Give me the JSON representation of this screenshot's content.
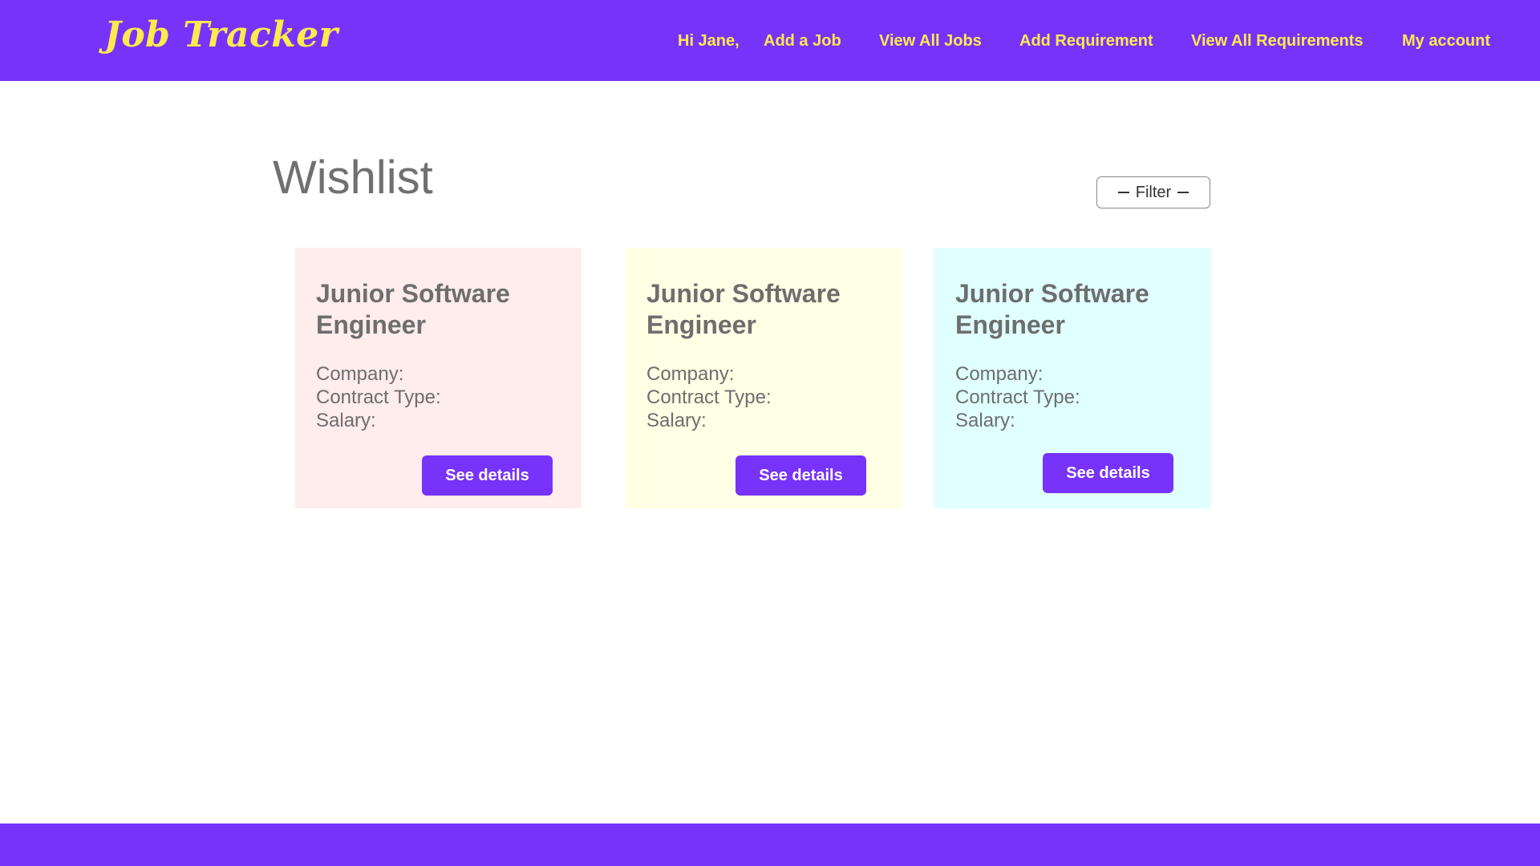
{
  "header": {
    "logo": "Job Tracker",
    "greeting": "Hi Jane,",
    "nav": {
      "add_job": "Add a Job",
      "view_jobs": "View All Jobs",
      "add_requirement": "Add Requirement",
      "view_requirements": "View All Requirements",
      "my_account": "My account"
    }
  },
  "main": {
    "title": "Wishlist",
    "filter_label": "Filter",
    "cards": [
      {
        "title": "Junior Software Engineer",
        "company_label": "Company:",
        "contract_label": "Contract Type:",
        "salary_label": "Salary:",
        "button": "See details",
        "color": "#ffecec"
      },
      {
        "title": "Junior Software Engineer",
        "company_label": "Company:",
        "contract_label": "Contract Type:",
        "salary_label": "Salary:",
        "button": "See details",
        "color": "#ffffe5"
      },
      {
        "title": "Junior Software Engineer",
        "company_label": "Company:",
        "contract_label": "Contract Type:",
        "salary_label": "Salary:",
        "button": "See details",
        "color": "#e0ffff"
      }
    ]
  },
  "colors": {
    "brand": "#7733fa",
    "accent_text": "#ffe94d"
  }
}
